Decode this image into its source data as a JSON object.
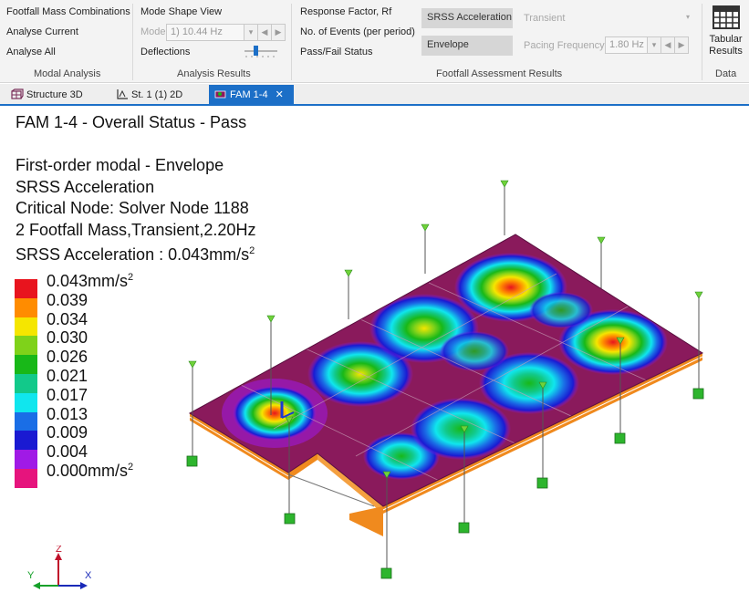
{
  "ribbon": {
    "modal_analysis": {
      "label": "Modal Analysis",
      "footfall_mass_combinations": "Footfall Mass Combinations",
      "analyse_current": "Analyse Current",
      "analyse_all": "Analyse All"
    },
    "analysis_results": {
      "label": "Analysis Results",
      "mode_shape_view": "Mode Shape View",
      "mode_label": "Mode",
      "mode_value": "1) 10.44 Hz",
      "deflections": "Deflections"
    },
    "footfall_results": {
      "label": "Footfall Assessment Results",
      "response_factor": "Response Factor, Rf",
      "no_of_events": "No. of Events (per period)",
      "pass_fail_status": "Pass/Fail Status",
      "srss_acceleration": "SRSS Acceleration",
      "envelope": "Envelope",
      "transient_value": "Transient",
      "pacing_frequency_label": "Pacing Frequency",
      "pacing_frequency_value": "1.80 Hz"
    },
    "data": {
      "label": "Data",
      "tabular_results_line1": "Tabular",
      "tabular_results_line2": "Results"
    }
  },
  "tabs": [
    {
      "label": "Structure 3D",
      "icon": "structure-3d-icon",
      "active": false
    },
    {
      "label": "St. 1 (1) 2D",
      "icon": "drawing-2d-icon",
      "active": false
    },
    {
      "label": "FAM 1-4",
      "icon": "fam-icon",
      "active": true
    }
  ],
  "viewport": {
    "title": "FAM 1-4 - Overall Status - Pass",
    "info_lines": [
      "First-order modal - Envelope",
      "SRSS Acceleration",
      "Critical Node: Solver Node 1188",
      "2 Footfall Mass,Transient,2.20Hz"
    ],
    "srss_label": "SRSS Acceleration : 0.043mm/s",
    "unit_superscript": "2"
  },
  "legend": {
    "entries": [
      {
        "label": "0.043mm/s",
        "sup": "2",
        "color": "#e8141e"
      },
      {
        "label": "0.039",
        "sup": "",
        "color": "#ff8c00"
      },
      {
        "label": "0.034",
        "sup": "",
        "color": "#f5e600"
      },
      {
        "label": "0.030",
        "sup": "",
        "color": "#7fd21a"
      },
      {
        "label": "0.026",
        "sup": "",
        "color": "#18b818"
      },
      {
        "label": "0.021",
        "sup": "",
        "color": "#12c98a"
      },
      {
        "label": "0.017",
        "sup": "",
        "color": "#10e6ee"
      },
      {
        "label": "0.013",
        "sup": "",
        "color": "#1a6ee6"
      },
      {
        "label": "0.009",
        "sup": "",
        "color": "#1a1ad2"
      },
      {
        "label": "0.004",
        "sup": "",
        "color": "#a01ae6"
      },
      {
        "label": "0.000mm/s",
        "sup": "2",
        "color": "#e6147d"
      }
    ]
  },
  "triad": {
    "x": "X",
    "y": "Y",
    "z": "Z"
  },
  "colors": {
    "accent": "#1c6fc7",
    "slab": "#8a1a5c",
    "slab_edge": "#f08a1e",
    "support": "#2db52d"
  }
}
